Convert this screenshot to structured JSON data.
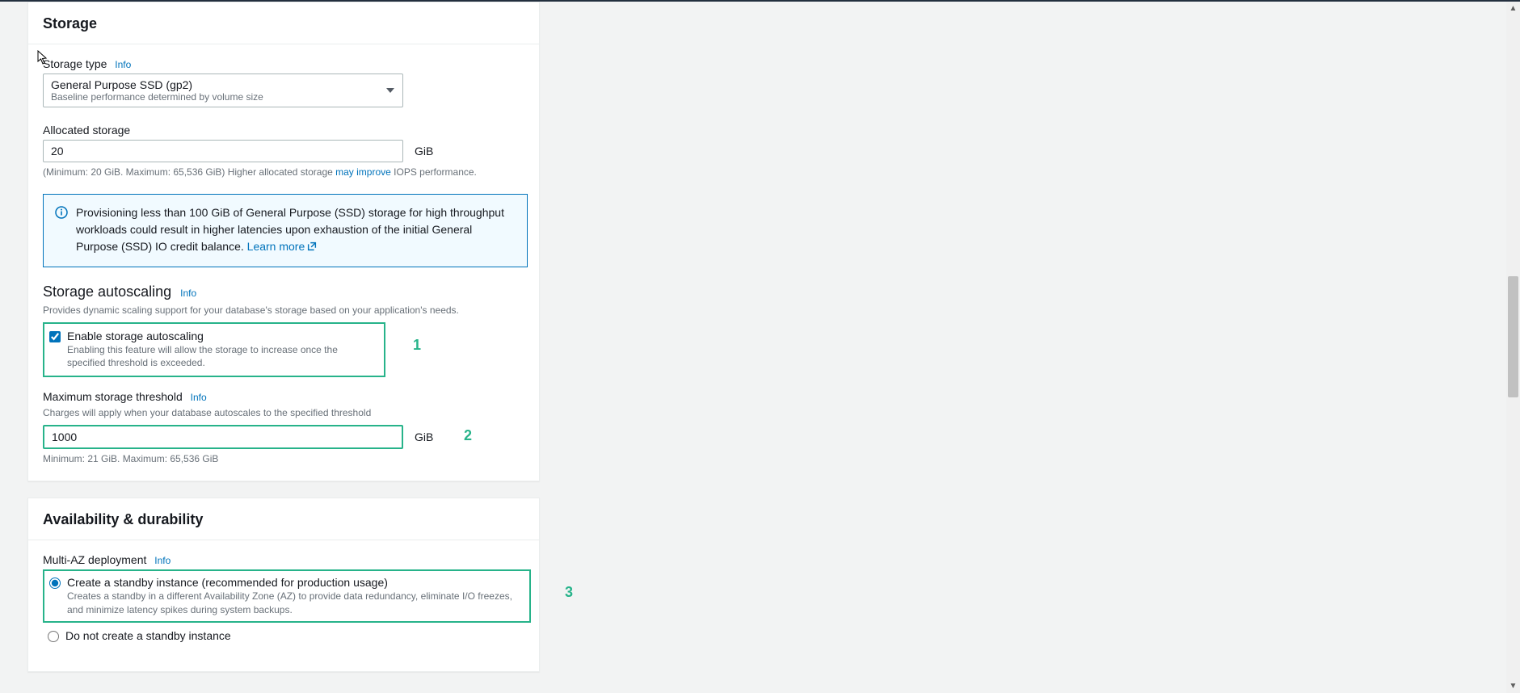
{
  "storage": {
    "title": "Storage",
    "storage_type": {
      "label": "Storage type",
      "info": "Info",
      "selected": "General Purpose SSD (gp2)",
      "sub": "Baseline performance determined by volume size"
    },
    "allocated": {
      "label": "Allocated storage",
      "value": "20",
      "unit": "GiB",
      "helper_prefix": "(Minimum: 20 GiB. Maximum: 65,536 GiB) Higher allocated storage ",
      "helper_link": "may improve",
      "helper_suffix": " IOPS performance."
    },
    "alert": {
      "text": "Provisioning less than 100 GiB of General Purpose (SSD) storage for high throughput workloads could result in higher latencies upon exhaustion of the initial General Purpose (SSD) IO credit balance. ",
      "link": "Learn more"
    },
    "autoscaling": {
      "title": "Storage autoscaling",
      "info": "Info",
      "desc": "Provides dynamic scaling support for your database's storage based on your application's needs.",
      "enable_label": "Enable storage autoscaling",
      "enable_desc": "Enabling this feature will allow the storage to increase once the specified threshold is exceeded.",
      "threshold_label": "Maximum storage threshold",
      "threshold_info": "Info",
      "threshold_desc": "Charges will apply when your database autoscales to the specified threshold",
      "threshold_value": "1000",
      "threshold_unit": "GiB",
      "threshold_minmax": "Minimum: 21 GiB. Maximum: 65,536 GiB"
    }
  },
  "availability": {
    "title": "Availability & durability",
    "multi_az": {
      "label": "Multi-AZ deployment",
      "info": "Info",
      "opt1_label": "Create a standby instance (recommended for production usage)",
      "opt1_desc": "Creates a standby in a different Availability Zone (AZ) to provide data redundancy, eliminate I/O freezes, and minimize latency spikes during system backups.",
      "opt2_label": "Do not create a standby instance"
    }
  },
  "annotations": {
    "one": "1",
    "two": "2",
    "three": "3"
  }
}
